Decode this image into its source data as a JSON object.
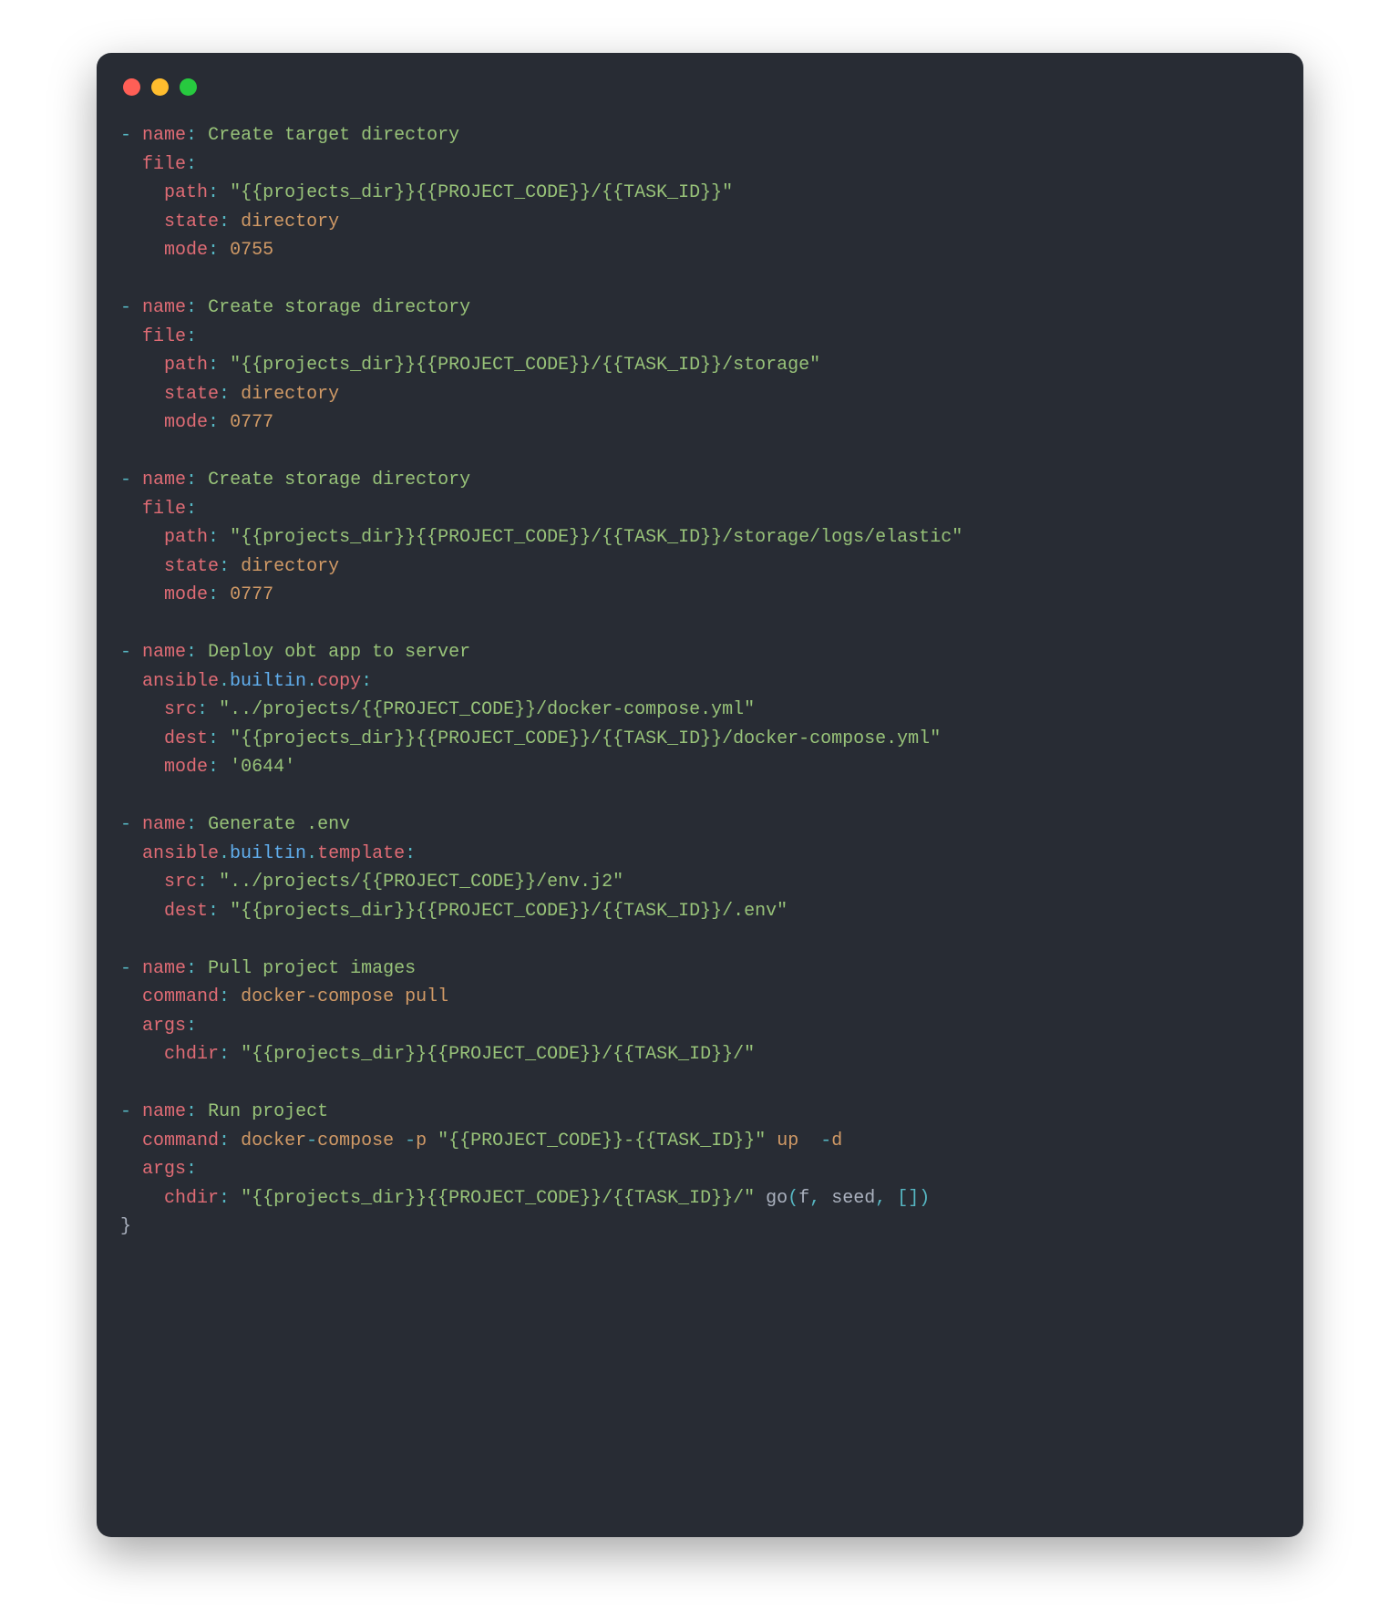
{
  "colors": {
    "bg": "#282c34",
    "red": "#ff5f56",
    "yellow": "#ffbd2e",
    "green": "#27c93f"
  },
  "code": {
    "lines": [
      [
        [
          "pn",
          "- "
        ],
        [
          "ky",
          "name"
        ],
        [
          "pn",
          ":"
        ],
        [
          "tx",
          " "
        ],
        [
          "st",
          "Create target directory"
        ]
      ],
      [
        [
          "tx",
          "  "
        ],
        [
          "ky",
          "file"
        ],
        [
          "pn",
          ":"
        ]
      ],
      [
        [
          "tx",
          "    "
        ],
        [
          "ky",
          "path"
        ],
        [
          "pn",
          ":"
        ],
        [
          "tx",
          " "
        ],
        [
          "st",
          "\"{{projects_dir}}{{PROJECT_CODE}}/{{TASK_ID}}\""
        ]
      ],
      [
        [
          "tx",
          "    "
        ],
        [
          "ky",
          "state"
        ],
        [
          "pn",
          ":"
        ],
        [
          "tx",
          " "
        ],
        [
          "nm",
          "directory"
        ]
      ],
      [
        [
          "tx",
          "    "
        ],
        [
          "ky",
          "mode"
        ],
        [
          "pn",
          ":"
        ],
        [
          "tx",
          " "
        ],
        [
          "nm",
          "0755"
        ]
      ],
      [],
      [
        [
          "pn",
          "- "
        ],
        [
          "ky",
          "name"
        ],
        [
          "pn",
          ":"
        ],
        [
          "tx",
          " "
        ],
        [
          "st",
          "Create storage directory"
        ]
      ],
      [
        [
          "tx",
          "  "
        ],
        [
          "ky",
          "file"
        ],
        [
          "pn",
          ":"
        ]
      ],
      [
        [
          "tx",
          "    "
        ],
        [
          "ky",
          "path"
        ],
        [
          "pn",
          ":"
        ],
        [
          "tx",
          " "
        ],
        [
          "st",
          "\"{{projects_dir}}{{PROJECT_CODE}}/{{TASK_ID}}/storage\""
        ]
      ],
      [
        [
          "tx",
          "    "
        ],
        [
          "ky",
          "state"
        ],
        [
          "pn",
          ":"
        ],
        [
          "tx",
          " "
        ],
        [
          "nm",
          "directory"
        ]
      ],
      [
        [
          "tx",
          "    "
        ],
        [
          "ky",
          "mode"
        ],
        [
          "pn",
          ":"
        ],
        [
          "tx",
          " "
        ],
        [
          "nm",
          "0777"
        ]
      ],
      [],
      [
        [
          "pn",
          "- "
        ],
        [
          "ky",
          "name"
        ],
        [
          "pn",
          ":"
        ],
        [
          "tx",
          " "
        ],
        [
          "st",
          "Create storage directory"
        ]
      ],
      [
        [
          "tx",
          "  "
        ],
        [
          "ky",
          "file"
        ],
        [
          "pn",
          ":"
        ]
      ],
      [
        [
          "tx",
          "    "
        ],
        [
          "ky",
          "path"
        ],
        [
          "pn",
          ":"
        ],
        [
          "tx",
          " "
        ],
        [
          "st",
          "\"{{projects_dir}}{{PROJECT_CODE}}/{{TASK_ID}}/storage/logs/elastic\""
        ]
      ],
      [
        [
          "tx",
          "    "
        ],
        [
          "ky",
          "state"
        ],
        [
          "pn",
          ":"
        ],
        [
          "tx",
          " "
        ],
        [
          "nm",
          "directory"
        ]
      ],
      [
        [
          "tx",
          "    "
        ],
        [
          "ky",
          "mode"
        ],
        [
          "pn",
          ":"
        ],
        [
          "tx",
          " "
        ],
        [
          "nm",
          "0777"
        ]
      ],
      [],
      [
        [
          "pn",
          "- "
        ],
        [
          "ky",
          "name"
        ],
        [
          "pn",
          ":"
        ],
        [
          "tx",
          " "
        ],
        [
          "st",
          "Deploy obt app to server"
        ]
      ],
      [
        [
          "tx",
          "  "
        ],
        [
          "ky",
          "ansible"
        ],
        [
          "pn",
          "."
        ],
        [
          "fn",
          "builtin"
        ],
        [
          "pn",
          "."
        ],
        [
          "ky",
          "copy"
        ],
        [
          "pn",
          ":"
        ]
      ],
      [
        [
          "tx",
          "    "
        ],
        [
          "ky",
          "src"
        ],
        [
          "pn",
          ":"
        ],
        [
          "tx",
          " "
        ],
        [
          "st",
          "\"../projects/{{PROJECT_CODE}}/docker-compose.yml\""
        ]
      ],
      [
        [
          "tx",
          "    "
        ],
        [
          "ky",
          "dest"
        ],
        [
          "pn",
          ":"
        ],
        [
          "tx",
          " "
        ],
        [
          "st",
          "\"{{projects_dir}}{{PROJECT_CODE}}/{{TASK_ID}}/docker-compose.yml\""
        ]
      ],
      [
        [
          "tx",
          "    "
        ],
        [
          "ky",
          "mode"
        ],
        [
          "pn",
          ":"
        ],
        [
          "tx",
          " "
        ],
        [
          "st",
          "'0644'"
        ]
      ],
      [],
      [
        [
          "pn",
          "- "
        ],
        [
          "ky",
          "name"
        ],
        [
          "pn",
          ":"
        ],
        [
          "tx",
          " "
        ],
        [
          "st",
          "Generate .env"
        ]
      ],
      [
        [
          "tx",
          "  "
        ],
        [
          "ky",
          "ansible"
        ],
        [
          "pn",
          "."
        ],
        [
          "fn",
          "builtin"
        ],
        [
          "pn",
          "."
        ],
        [
          "ky",
          "template"
        ],
        [
          "pn",
          ":"
        ]
      ],
      [
        [
          "tx",
          "    "
        ],
        [
          "ky",
          "src"
        ],
        [
          "pn",
          ":"
        ],
        [
          "tx",
          " "
        ],
        [
          "st",
          "\"../projects/{{PROJECT_CODE}}/env.j2\""
        ]
      ],
      [
        [
          "tx",
          "    "
        ],
        [
          "ky",
          "dest"
        ],
        [
          "pn",
          ":"
        ],
        [
          "tx",
          " "
        ],
        [
          "st",
          "\"{{projects_dir}}{{PROJECT_CODE}}/{{TASK_ID}}/.env\""
        ]
      ],
      [],
      [
        [
          "pn",
          "- "
        ],
        [
          "ky",
          "name"
        ],
        [
          "pn",
          ":"
        ],
        [
          "tx",
          " "
        ],
        [
          "st",
          "Pull project images"
        ]
      ],
      [
        [
          "tx",
          "  "
        ],
        [
          "ky",
          "command"
        ],
        [
          "pn",
          ":"
        ],
        [
          "tx",
          " "
        ],
        [
          "nm",
          "docker-compose pull"
        ]
      ],
      [
        [
          "tx",
          "  "
        ],
        [
          "ky",
          "args"
        ],
        [
          "pn",
          ":"
        ]
      ],
      [
        [
          "tx",
          "    "
        ],
        [
          "ky",
          "chdir"
        ],
        [
          "pn",
          ":"
        ],
        [
          "tx",
          " "
        ],
        [
          "st",
          "\"{{projects_dir}}{{PROJECT_CODE}}/{{TASK_ID}}/\""
        ]
      ],
      [],
      [
        [
          "pn",
          "- "
        ],
        [
          "ky",
          "name"
        ],
        [
          "pn",
          ":"
        ],
        [
          "tx",
          " "
        ],
        [
          "st",
          "Run project"
        ]
      ],
      [
        [
          "tx",
          "  "
        ],
        [
          "ky",
          "command"
        ],
        [
          "pn",
          ":"
        ],
        [
          "tx",
          " "
        ],
        [
          "nm",
          "docker"
        ],
        [
          "pn",
          "-"
        ],
        [
          "nm",
          "compose "
        ],
        [
          "pn",
          "-"
        ],
        [
          "nm",
          "p "
        ],
        [
          "st",
          "\"{{PROJECT_CODE}}-{{TASK_ID}}\""
        ],
        [
          "nm",
          " up  "
        ],
        [
          "pn",
          "-"
        ],
        [
          "nm",
          "d"
        ]
      ],
      [
        [
          "tx",
          "  "
        ],
        [
          "ky",
          "args"
        ],
        [
          "pn",
          ":"
        ]
      ],
      [
        [
          "tx",
          "    "
        ],
        [
          "ky",
          "chdir"
        ],
        [
          "pn",
          ":"
        ],
        [
          "tx",
          " "
        ],
        [
          "st",
          "\"{{projects_dir}}{{PROJECT_CODE}}/{{TASK_ID}}/\""
        ],
        [
          "tx",
          " go"
        ],
        [
          "pn",
          "("
        ],
        [
          "tx",
          "f"
        ],
        [
          "pn",
          ","
        ],
        [
          "tx",
          " seed"
        ],
        [
          "pn",
          ","
        ],
        [
          "tx",
          " "
        ],
        [
          "pn",
          "["
        ],
        [
          "pn",
          "]"
        ],
        [
          "pn",
          ")"
        ]
      ],
      [
        [
          "tx",
          "}"
        ]
      ]
    ]
  }
}
